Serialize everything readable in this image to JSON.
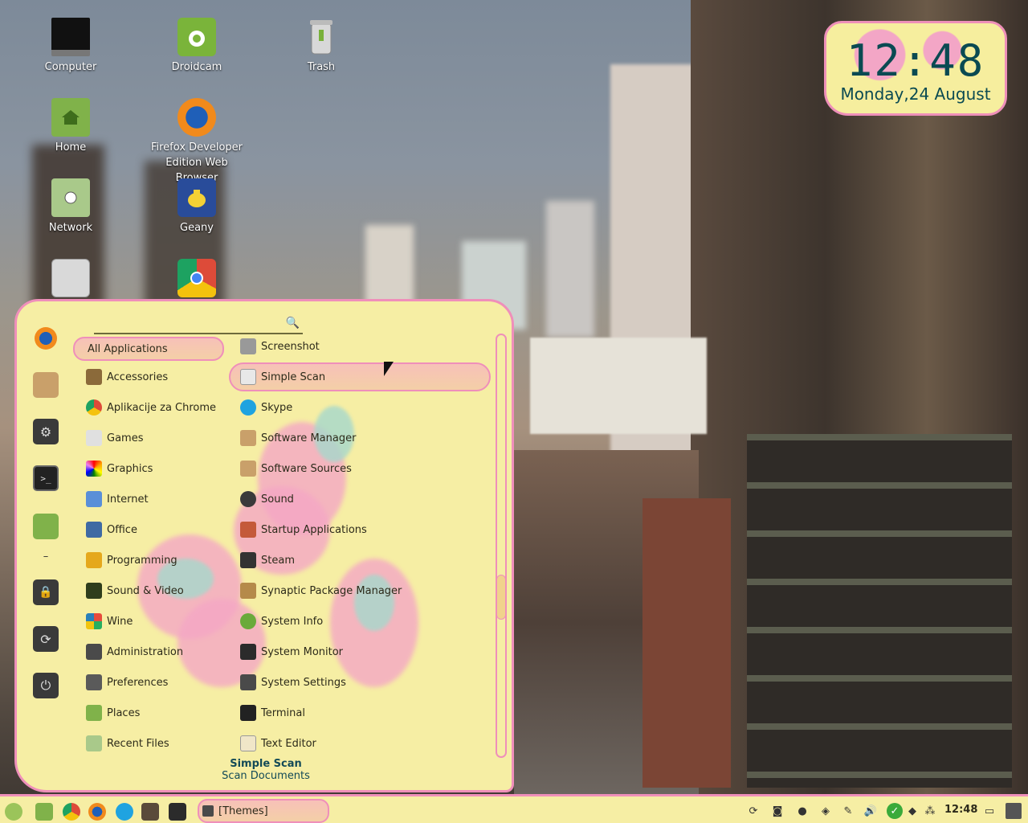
{
  "desktop": {
    "icons": [
      {
        "label": "Computer",
        "icon": "monitor-icon"
      },
      {
        "label": "Droidcam",
        "icon": "droidcam-icon"
      },
      {
        "label": "Trash",
        "icon": "trash-icon"
      },
      {
        "label": "Home",
        "icon": "home-folder-icon"
      },
      {
        "label": "Firefox Developer Edition Web Browser",
        "icon": "firefox-icon"
      },
      {
        "label": "Network",
        "icon": "network-folder-icon"
      },
      {
        "label": "Geany",
        "icon": "geany-icon"
      },
      {
        "label": "",
        "icon": "usb-drive-icon"
      },
      {
        "label": "",
        "icon": "chrome-icon"
      }
    ]
  },
  "clock": {
    "time": "12:48",
    "date": "Monday,24 August"
  },
  "menu": {
    "search": {
      "value": "",
      "placeholder": ""
    },
    "favorites": [
      "firefox-icon",
      "package-icon",
      "settings-icon",
      "terminal-icon",
      "folder-icon",
      "separator",
      "lock-icon",
      "logout-icon",
      "power-icon"
    ],
    "categories": [
      {
        "label": "All Applications",
        "selected": true
      },
      {
        "label": "Accessories"
      },
      {
        "label": "Aplikacije za Chrome"
      },
      {
        "label": "Games"
      },
      {
        "label": "Graphics"
      },
      {
        "label": "Internet"
      },
      {
        "label": "Office"
      },
      {
        "label": "Programming"
      },
      {
        "label": "Sound & Video"
      },
      {
        "label": "Wine"
      },
      {
        "label": "Administration"
      },
      {
        "label": "Preferences"
      },
      {
        "label": "Places"
      },
      {
        "label": "Recent Files"
      }
    ],
    "apps": [
      {
        "label": "Screenshot"
      },
      {
        "label": "Simple Scan",
        "highlighted": true
      },
      {
        "label": "Skype"
      },
      {
        "label": "Software Manager"
      },
      {
        "label": "Software Sources"
      },
      {
        "label": "Sound"
      },
      {
        "label": "Startup Applications"
      },
      {
        "label": "Steam"
      },
      {
        "label": "Synaptic Package Manager"
      },
      {
        "label": "System Info"
      },
      {
        "label": "System Monitor"
      },
      {
        "label": "System Settings"
      },
      {
        "label": "Terminal"
      },
      {
        "label": "Text Editor"
      }
    ],
    "description": {
      "name": "Simple Scan",
      "text": "Scan Documents"
    }
  },
  "panel": {
    "launchers": [
      "menu-icon",
      "files-icon",
      "chrome-icon",
      "firefox-icon",
      "skype-icon",
      "video-icon",
      "system-monitor-icon"
    ],
    "task": {
      "label": "[Themes]",
      "icon": "settings-icon"
    },
    "tray": [
      "refresh-icon",
      "camera-icon",
      "user-icon",
      "dropbox-icon",
      "pen-icon",
      "volume-icon",
      "update-ok-icon",
      "shield-icon",
      "network-icon"
    ],
    "time": "12:48"
  },
  "colors": {
    "menu_bg": "#f6eea4",
    "accent_pink": "#ef8fba",
    "text_teal": "#134a57"
  }
}
